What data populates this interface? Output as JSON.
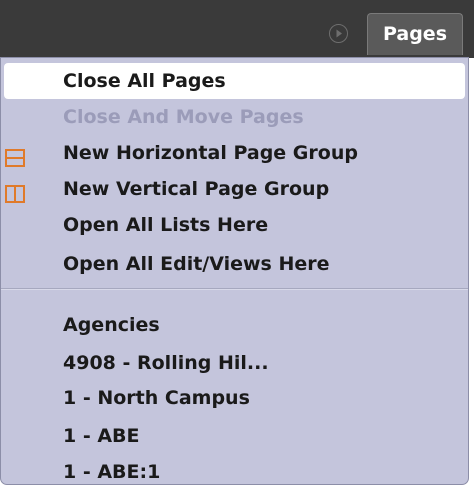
{
  "header": {
    "pages_label": "Pages",
    "accent_color": "#e07a2a"
  },
  "menu": {
    "actions": [
      {
        "label": "Close All Pages",
        "highlighted": true
      },
      {
        "label": "Close And Move Pages",
        "disabled": true
      },
      {
        "label": "New Horizontal Page Group",
        "icon": "horizontal-split-icon"
      },
      {
        "label": "New Vertical Page Group",
        "icon": "vertical-split-icon"
      },
      {
        "label": "Open All Lists Here"
      },
      {
        "label": "Open All Edit/Views Here"
      }
    ],
    "pages": [
      {
        "label": "Agencies"
      },
      {
        "label": "4908 - Rolling Hil..."
      },
      {
        "label": "1 - North Campus"
      },
      {
        "label": "1 - ABE"
      },
      {
        "label": "1 - ABE:1"
      }
    ]
  }
}
